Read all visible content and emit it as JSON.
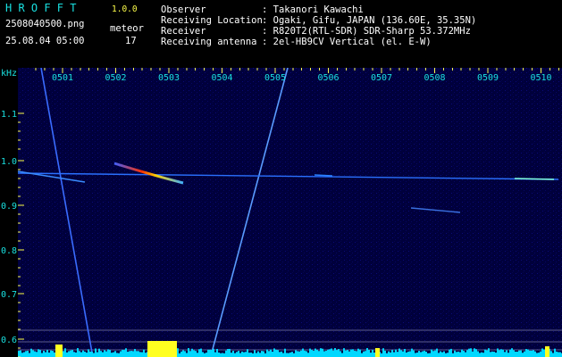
{
  "app": {
    "name": "H R O F F T",
    "version": "1.0.0"
  },
  "file": {
    "name": "2508040500.png",
    "datetime": "25.08.04 05:00"
  },
  "meteor": {
    "label": "meteor",
    "count": "17"
  },
  "info": {
    "labels": [
      "Observer",
      "Receiving Location",
      "Receiver",
      "Receiving antenna"
    ],
    "values": [
      ": Takanori Kawachi",
      ": Ogaki, Gifu, JAPAN (136.60E, 35.35N)",
      ": R820T2(RTL-SDR) SDR-Sharp 53.372MHz",
      ": 2el-HB9CV Vertical (el. E-W)"
    ]
  },
  "axis": {
    "unit": "kHz",
    "y_ticks": [
      "1.1",
      "1.0",
      "0.9",
      "0.8",
      "0.7",
      "0.6"
    ],
    "x_ticks": [
      "0501",
      "0502",
      "0503",
      "0504",
      "0505",
      "0506",
      "0507",
      "0508",
      "0509",
      "0510"
    ]
  },
  "colors": {
    "label": "#19e0e0",
    "tick": "#ffff4a",
    "text": "#ffffff",
    "signal": "#ff3000",
    "plot_bg": "#00003a",
    "baseline": "#00d8ff"
  }
}
